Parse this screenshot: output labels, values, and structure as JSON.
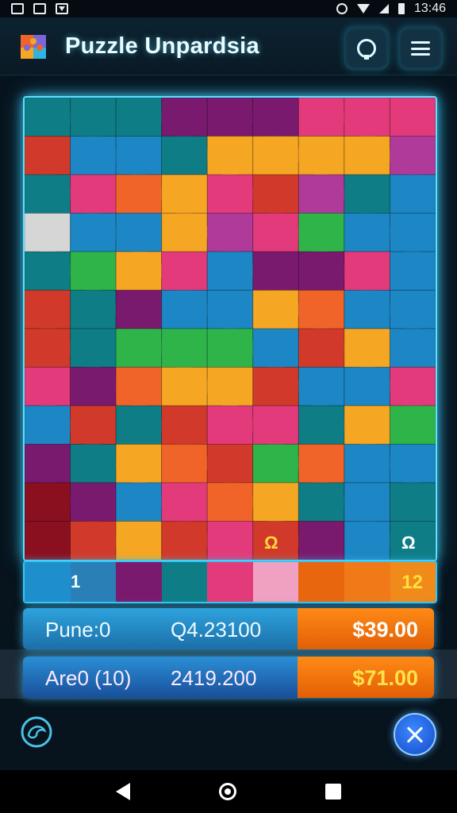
{
  "status_bar": {
    "time": "13:46"
  },
  "header": {
    "title": "Puzzle Unpardsia"
  },
  "board": {
    "rows": 12,
    "cols": 9,
    "palette": [
      "#1d86c4",
      "#0f7d86",
      "#e23a7a",
      "#f5a623",
      "#2fb44a",
      "#d13a2a",
      "#7a1a6e",
      "#f0642a",
      "#8a1020",
      "#b03a9a",
      "#d6d6d6",
      "#49c9a0"
    ],
    "cells": [
      "111666222",
      "500133339",
      "127325910",
      "a00392400",
      "143206620",
      "516003700",
      "514440530",
      "267335002",
      "051522134",
      "613754700",
      "860273101",
      "853525601"
    ],
    "badges": [
      "Ω",
      "Ω"
    ]
  },
  "tray": {
    "left_label": "1",
    "right_label": "12"
  },
  "stats": [
    {
      "label": "Pune:0",
      "value": "Q4.23100",
      "price": "$39.00"
    },
    {
      "label": "Are0 (10)",
      "value": "2419.200",
      "price": "$71.00"
    }
  ],
  "colors": {
    "accent": "#5fe0ff",
    "price_bg": "#ff8a16",
    "stat_bg": "#2da3dd"
  }
}
